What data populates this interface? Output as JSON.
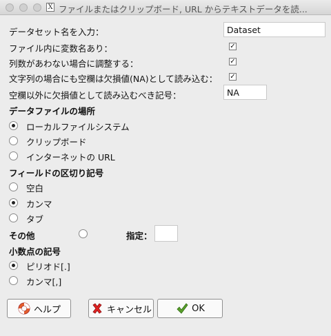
{
  "window": {
    "title": "ファイルまたはクリップボード, URL からテキストデータを読..."
  },
  "fields": {
    "dataset_name_label": "データセット名を入力：",
    "dataset_name_value": "Dataset",
    "varnames_label": "ファイル内に変数名あり：",
    "varnames_checked": true,
    "pad_label": "列数があわない場合に調整する：",
    "pad_checked": true,
    "na_strings_label": "文字列の場合にも空欄は欠損値(NA)として読み込む：",
    "na_strings_checked": true,
    "missing_label": "空欄以外に欠損値として読み込むべき記号：",
    "missing_value": "NA"
  },
  "location": {
    "heading": "データファイルの場所",
    "options": [
      "ローカルファイルシステム",
      "クリップボード",
      "インターネットの URL"
    ],
    "selected": 0
  },
  "delimiter": {
    "heading": "フィールドの区切り記号",
    "options": [
      "空白",
      "カンマ",
      "タブ"
    ],
    "selected": 1,
    "other_label": "その他",
    "specify_label": "指定：",
    "specify_value": ""
  },
  "decimal": {
    "heading": "小数点の記号",
    "options": [
      "ピリオド[.]",
      "カンマ[,]"
    ],
    "selected": 0
  },
  "buttons": {
    "help": "ヘルプ",
    "cancel": "キャンセル",
    "ok": "OK"
  },
  "icons": {
    "help": "lifebuoy-icon",
    "cancel": "red-x-icon",
    "ok": "green-check-icon"
  }
}
